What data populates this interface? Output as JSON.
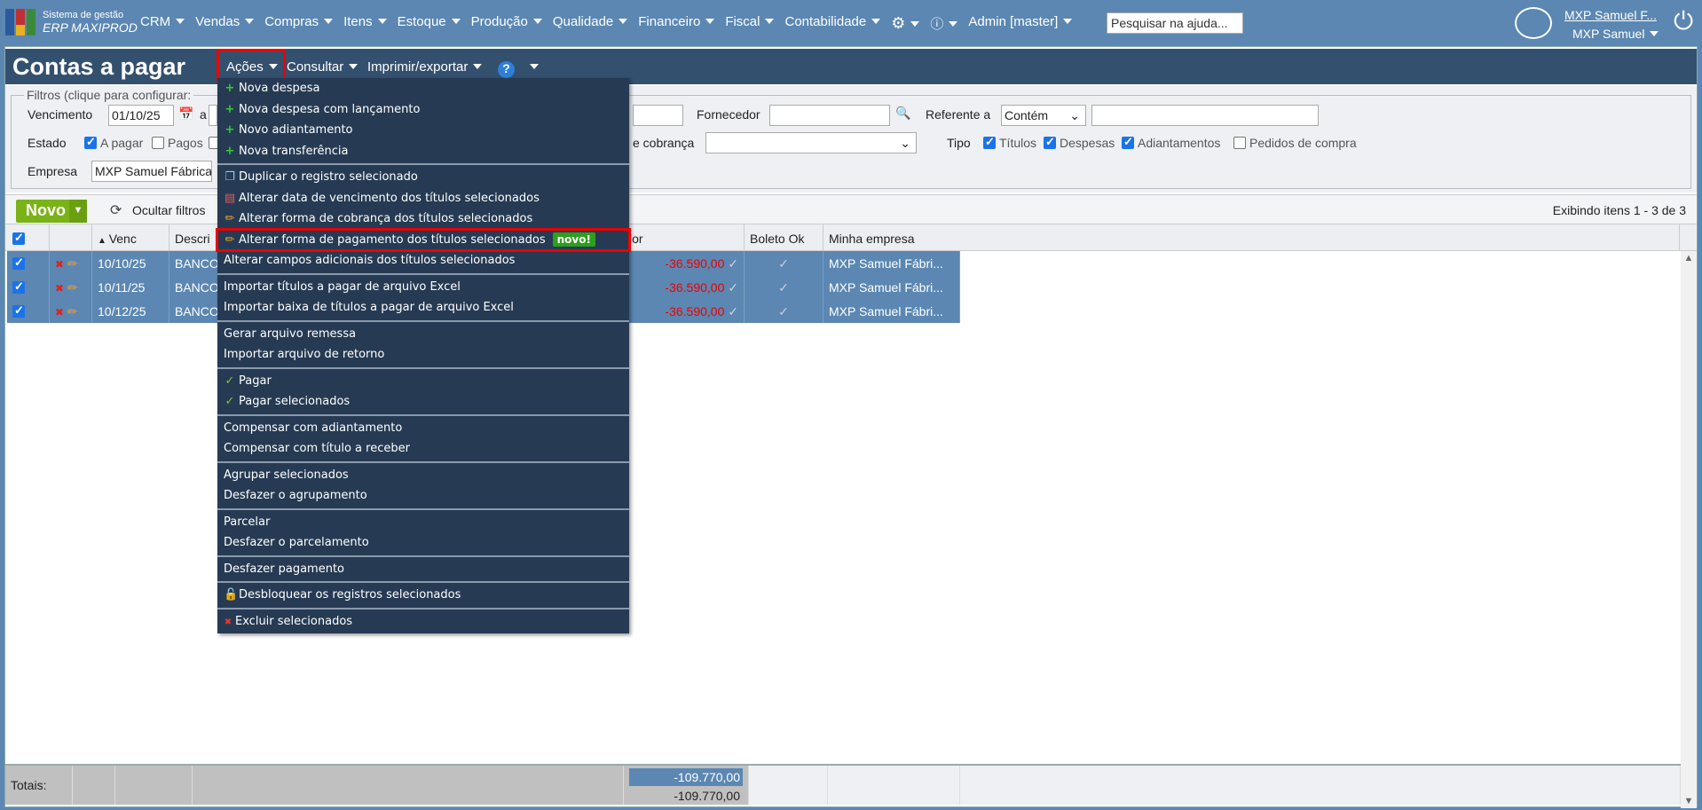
{
  "topbar": {
    "logo_line1": "Sistema de gestão",
    "logo_line2": "ERP MAXIPROD",
    "nav": [
      "CRM",
      "Vendas",
      "Compras",
      "Itens",
      "Estoque",
      "Produção",
      "Qualidade",
      "Financeiro",
      "Fiscal",
      "Contabilidade"
    ],
    "admin": "Admin [master]",
    "search_placeholder": "Pesquisar na ajuda...",
    "user_link": "MXP Samuel F...",
    "user_company": "MXP Samuel"
  },
  "page": {
    "title": "Contas a pagar",
    "menus": [
      "Ações",
      "Consultar",
      "Imprimir/exportar"
    ]
  },
  "filters": {
    "legend": "Filtros (clique para configurar:",
    "vencimento_label": "Vencimento",
    "vencimento_from": "01/10/25",
    "a": "a",
    "fornecedor_label": "Fornecedor",
    "referente_label": "Referente a",
    "referente_op": "Contém",
    "estado_label": "Estado",
    "estado": [
      {
        "label": "A pagar",
        "checked": true
      },
      {
        "label": "Pagos",
        "checked": false
      }
    ],
    "cobranca_label": "e cobrança",
    "tipo_label": "Tipo",
    "tipo": [
      {
        "label": "Títulos",
        "checked": true
      },
      {
        "label": "Despesas",
        "checked": true
      },
      {
        "label": "Adiantamentos",
        "checked": true
      },
      {
        "label": "Pedidos de compra",
        "checked": false
      }
    ],
    "empresa_label": "Empresa",
    "empresa_value": "MXP Samuel Fábrica"
  },
  "toolbar": {
    "novo": "Novo",
    "ocultar": "Ocultar filtros",
    "exibindo": "Exibindo itens 1 - 3 de 3"
  },
  "table": {
    "headers": {
      "venc": "Venc",
      "descr": "Descri",
      "valor": "lor",
      "boleto": "Boleto Ok",
      "empresa": "Minha empresa"
    },
    "rows": [
      {
        "venc": "10/10/25",
        "descr": "BANCO",
        "valor": "-36.590,00",
        "empresa": "MXP Samuel Fábri..."
      },
      {
        "venc": "10/11/25",
        "descr": "BANCO",
        "valor": "-36.590,00",
        "empresa": "MXP Samuel Fábri..."
      },
      {
        "venc": "10/12/25",
        "descr": "BANCO",
        "valor": "-36.590,00",
        "empresa": "MXP Samuel Fábri..."
      }
    ],
    "totals_label": "Totais:",
    "total_selected": "-109.770,00",
    "total": "-109.770,00"
  },
  "menu": {
    "groups": [
      [
        {
          "label": "Nova despesa",
          "icon": "plus"
        },
        {
          "label": "Nova despesa com lançamento",
          "icon": "plus"
        },
        {
          "label": "Novo adiantamento",
          "icon": "plus"
        },
        {
          "label": "Nova transferência",
          "icon": "plus"
        }
      ],
      [
        {
          "label": "Duplicar o registro selecionado",
          "icon": "copy"
        },
        {
          "label": "Alterar data de vencimento dos títulos selecionados",
          "icon": "calendar"
        },
        {
          "label": "Alterar forma de cobrança dos títulos selecionados",
          "icon": "pencil"
        },
        {
          "label": "Alterar forma de pagamento dos títulos selecionados",
          "icon": "pencil",
          "badge": "novo!"
        },
        {
          "label": "Alterar campos adicionais dos títulos selecionados",
          "icon": ""
        }
      ],
      [
        {
          "label": "Importar títulos a pagar de arquivo Excel",
          "icon": ""
        },
        {
          "label": "Importar baixa de títulos a pagar de arquivo Excel",
          "icon": ""
        }
      ],
      [
        {
          "label": "Gerar arquivo remessa",
          "icon": ""
        },
        {
          "label": "Importar arquivo de retorno",
          "icon": ""
        }
      ],
      [
        {
          "label": "Pagar",
          "icon": "check"
        },
        {
          "label": "Pagar selecionados",
          "icon": "check"
        }
      ],
      [
        {
          "label": "Compensar com adiantamento",
          "icon": ""
        },
        {
          "label": "Compensar com título a receber",
          "icon": ""
        }
      ],
      [
        {
          "label": "Agrupar selecionados",
          "icon": ""
        },
        {
          "label": "Desfazer o agrupamento",
          "icon": ""
        }
      ],
      [
        {
          "label": "Parcelar",
          "icon": ""
        },
        {
          "label": "Desfazer o parcelamento",
          "icon": ""
        }
      ],
      [
        {
          "label": "Desfazer pagamento",
          "icon": ""
        }
      ],
      [
        {
          "label": "Desbloquear os registros selecionados",
          "icon": "unlock"
        }
      ],
      [
        {
          "label": "Excluir selecionados",
          "icon": "x"
        }
      ]
    ]
  },
  "colors": {
    "topbar": "#5b87b2",
    "titlebar": "#34506f",
    "menu": "#263b53",
    "novo": "#7ab317",
    "highlight": "#e00000"
  }
}
